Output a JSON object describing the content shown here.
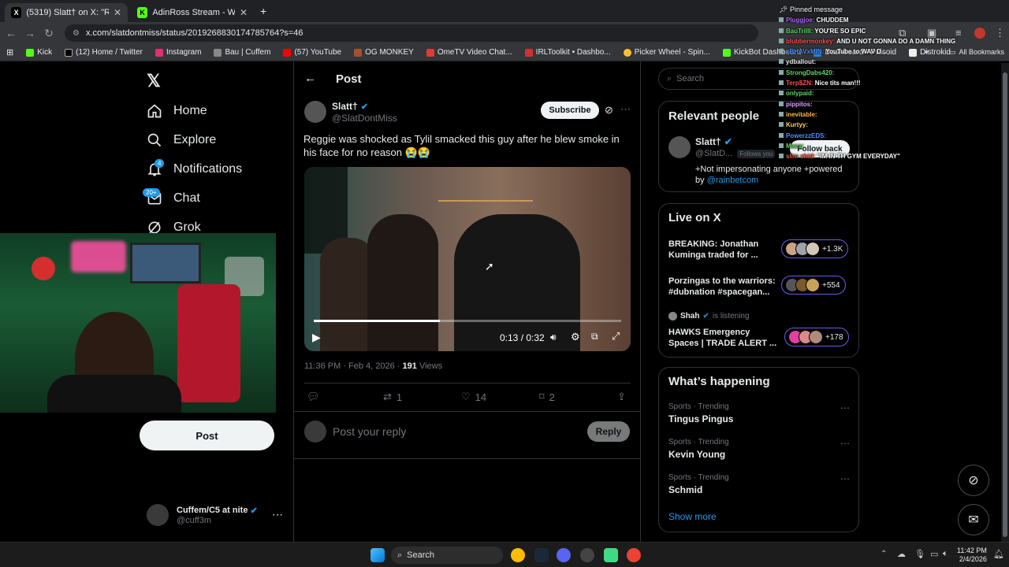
{
  "browser": {
    "tabs": [
      {
        "title": "(5319) Slatt† on X: \"Reggie was",
        "active": true
      },
      {
        "title": "AdinRoss Stream - Watch Live o",
        "active": false
      }
    ],
    "url": "x.com/slatdontmiss/status/2019268830174785764?s=46",
    "bookmarks": [
      "Kick",
      "(12) Home / Twitter",
      "Instagram",
      "Bau | Cuffem",
      "(57) YouTube",
      "OG MONKEY",
      "OmeTV Video Chat...",
      "IRLToolkit • Dashbo...",
      "Picker Wheel - Spin...",
      "KickBot Dashboard",
      "Dashboard - Pulsoid",
      "Distrokid"
    ],
    "all_bookmarks": "All Bookmarks",
    "overflow": "»"
  },
  "nav": {
    "items": [
      {
        "label": "Home",
        "icon": "home-icon"
      },
      {
        "label": "Explore",
        "icon": "search-icon"
      },
      {
        "label": "Notifications",
        "icon": "bell-icon",
        "badge": "4"
      },
      {
        "label": "Chat",
        "icon": "chat-icon",
        "badge": "20+"
      },
      {
        "label": "Grok",
        "icon": "grok-icon"
      }
    ],
    "post_button": "Post",
    "account": {
      "name": "Cuffem/C5 at nite",
      "handle": "@cuff3m"
    }
  },
  "post": {
    "header_title": "Post",
    "author_name": "Slatt†",
    "author_handle": "@SlatDontMiss",
    "subscribe_label": "Subscribe",
    "text": "Reggie was shocked as Tylil smacked this guy after he blew smoke in his face for no reason 😭😭",
    "video": {
      "time": "0:13 / 0:32",
      "progress": 0.41
    },
    "timestamp": "11:36 PM · Feb 4, 2026 · ",
    "views_count": "191",
    "views_label": " Views",
    "actions": {
      "replies": "",
      "reposts": "1",
      "likes": "14",
      "bookmarks": "2"
    },
    "reply_placeholder": "Post your reply",
    "reply_button": "Reply"
  },
  "sidebar": {
    "search_placeholder": "Search",
    "relevant_title": "Relevant people",
    "person": {
      "name": "Slatt†",
      "handle": "@SlatD...",
      "follows_you": "Follows you",
      "follow_back": "Follow back",
      "bio": "+Not impersonating anyone +powered by ",
      "bio_link": "@rainbetcom"
    },
    "live_title": "Live on X",
    "live": [
      {
        "title": "BREAKING: Jonathan Kuminga traded for ...",
        "count": "+1.3K"
      },
      {
        "title": "Porzingas to the warriors: #dubnation #spacegan...",
        "count": "+554"
      },
      {
        "host": "Shah",
        "status": "is listening",
        "title": "HAWKS Emergency Spaces | TRADE ALERT ...",
        "count": "+178"
      }
    ],
    "happening_title": "What’s happening",
    "trends": [
      {
        "meta": "Sports · Trending",
        "name": "Tingus Pingus"
      },
      {
        "meta": "Sports · Trending",
        "name": "Kevin Young"
      },
      {
        "meta": "Sports · Trending",
        "name": "Schmid"
      }
    ],
    "show_more": "Show more"
  },
  "chat_overlay": {
    "pinned": "Pinned message",
    "lines": [
      {
        "user": "Pluggjoe",
        "msg": "CHUDDEM",
        "color": "#b067ff"
      },
      {
        "user": "BauTrilll",
        "msg": "YOU'RE SO EPIC",
        "color": "#5cd65c"
      },
      {
        "user": "blubbermonkey",
        "msg": "AND U NOT GONNA DO A DAMN THING",
        "color": "#ff4d4d"
      },
      {
        "user": "xBHAVxMIN",
        "msg": "YouTube to WAV D...",
        "color": "#4f8bff"
      },
      {
        "user": "ydballout",
        "msg": "",
        "color": "#e7e9ea"
      },
      {
        "user": "StrongDabs420",
        "msg": "",
        "color": "#5cd65c"
      },
      {
        "user": "Terp$ZN",
        "msg": "Nice tits man!!!",
        "color": "#ff4d4d"
      },
      {
        "user": "onlypaid",
        "msg": "",
        "color": "#5cd65c"
      },
      {
        "user": "pippitos",
        "msg": "",
        "color": "#d99cff"
      },
      {
        "user": "inevitable",
        "msg": "",
        "color": "#ffb347"
      },
      {
        "user": "Kurtyy",
        "msg": "",
        "color": "#ffd24d"
      },
      {
        "user": "PowerzzEDS",
        "msg": "",
        "color": "#4f8bff"
      },
      {
        "user": "Maca",
        "msg": "",
        "color": "#5cd65c"
      },
      {
        "user": "slim shid",
        "msg": "\"IM IN TH GYM EVERYDAY\"",
        "color": "#ff4d4d"
      }
    ]
  },
  "taskbar": {
    "search": "Search",
    "time": "11:42 PM",
    "date": "2/4/2026"
  },
  "colors": {
    "accent": "#1d9bf0",
    "live_border": "#6b5ce7",
    "verified": "#1d9bf0"
  }
}
